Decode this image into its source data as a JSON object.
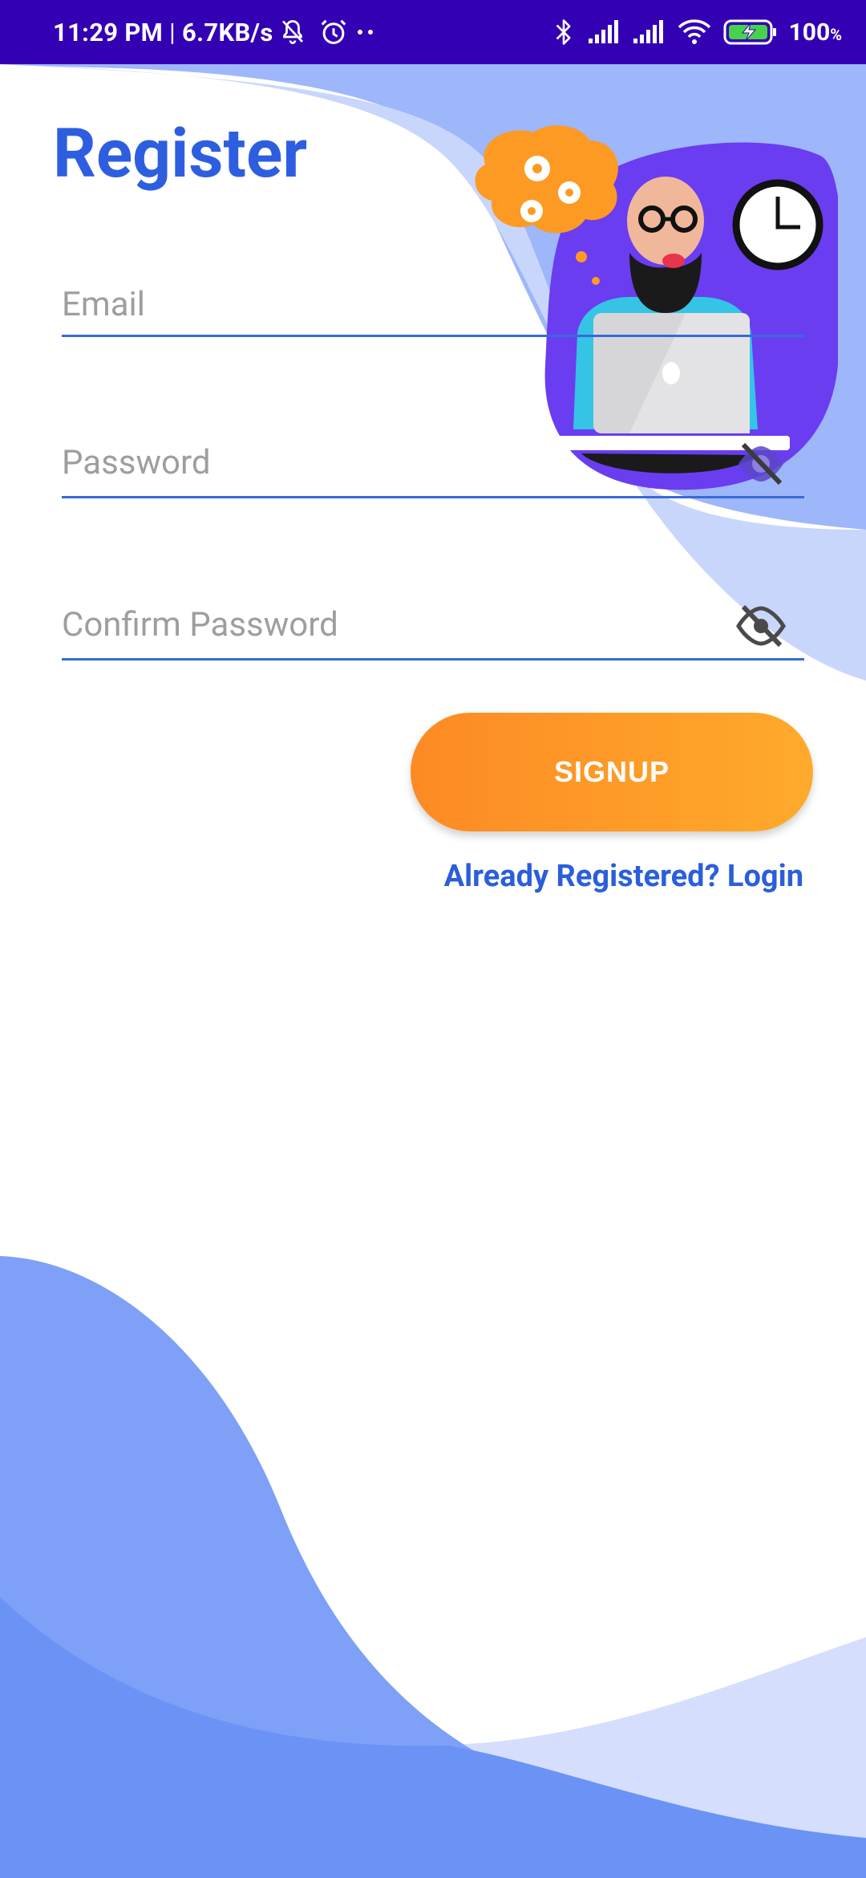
{
  "status_bar": {
    "time": "11:29 PM",
    "separator": "|",
    "net_speed": "6.7KB/s",
    "battery_percent": "100",
    "battery_unit": "%",
    "icons": [
      "muted-bell-icon",
      "alarm-icon",
      "more-dots-icon",
      "bluetooth-icon",
      "signal-icon",
      "signal-icon",
      "wifi-icon",
      "battery-charging-icon"
    ]
  },
  "page": {
    "title": "Register"
  },
  "form": {
    "email_placeholder": "Email",
    "password_placeholder": "Password",
    "confirm_password_placeholder": "Confirm Password",
    "visibility_icon": "eye-off-icon"
  },
  "actions": {
    "signup_label": "SIGNUP",
    "login_link": "Already Registered? Login"
  },
  "colors": {
    "status_bar": "#3300b3",
    "accent_blue": "#2e5ee0",
    "button_gradient_start": "#fd8a24",
    "button_gradient_end": "#feaa2c",
    "wave_dark": "#6d96f7",
    "wave_light": "#d2dcfb"
  }
}
